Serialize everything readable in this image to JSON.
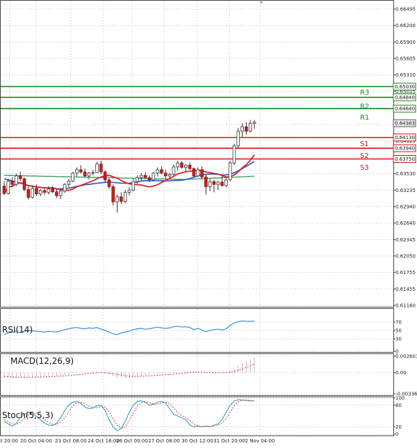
{
  "colors": {
    "resistance": "#1a8a1a",
    "support": "#d41010",
    "bull_candle": "#ffffff",
    "bear_candle": "#cc2020",
    "wick": "#333333",
    "ma_red": "#e02020",
    "ma_blue": "#3a5fd0",
    "ma_green": "#3aa060",
    "rsi": "#3a8ed8",
    "macd_hist": "#bbbbbb",
    "macd_signal": "#e03030",
    "stoch_main": "#30a0c0",
    "stoch_signal": "#e03030",
    "grid": "#b8b8b8",
    "panel_border": "#444444",
    "current_price_tag": "#eeeeee"
  },
  "chart_data": [
    {
      "type": "candlestick",
      "panel": "price",
      "yticks": [
        "0.66495",
        "0.66200",
        "0.65900",
        "0.65605",
        "0.65310",
        "0.65015",
        "0.64715",
        "0.64420",
        "0.64125",
        "0.63830",
        "0.63530",
        "0.63235",
        "0.62940",
        "0.62640",
        "0.62345",
        "0.62050",
        "0.61755",
        "0.61455",
        "0.61160"
      ],
      "ylim": [
        0.6116,
        0.665
      ],
      "current_price": "0.64383",
      "levels": [
        {
          "name": "R3",
          "value": "0.65030",
          "kind": "resistance"
        },
        {
          "name": "R2",
          "value": "0.64840",
          "kind": "resistance"
        },
        {
          "name": "R1",
          "value": "0.64640",
          "kind": "resistance"
        },
        {
          "name": "S1",
          "value": "0.64130",
          "kind": "support"
        },
        {
          "name": "S2",
          "value": "0.63940",
          "kind": "support"
        },
        {
          "name": "S3",
          "value": "0.63750",
          "kind": "support"
        }
      ],
      "xticks": [
        "ct 20:00",
        "20 Oct 04:00",
        "23 Oct 08:00",
        "24 Oct 16:00",
        "26 Oct 00:00",
        "27 Oct 08:00",
        "30 Oct 12:00",
        "31 Oct 20:00",
        "2 Nov 04:00"
      ],
      "ohlc": [
        [
          0.6327,
          0.6336,
          0.6311,
          0.6314
        ],
        [
          0.6314,
          0.634,
          0.6312,
          0.6336
        ],
        [
          0.6336,
          0.6343,
          0.6325,
          0.633
        ],
        [
          0.633,
          0.6349,
          0.6327,
          0.6345
        ],
        [
          0.6345,
          0.6352,
          0.6336,
          0.634
        ],
        [
          0.634,
          0.6342,
          0.6318,
          0.6321
        ],
        [
          0.6321,
          0.6326,
          0.6303,
          0.6307
        ],
        [
          0.6307,
          0.6328,
          0.6305,
          0.6323
        ],
        [
          0.6323,
          0.633,
          0.6309,
          0.6313
        ],
        [
          0.6313,
          0.6322,
          0.6309,
          0.6319
        ],
        [
          0.6319,
          0.6324,
          0.6311,
          0.6316
        ],
        [
          0.6316,
          0.6327,
          0.6312,
          0.6322
        ],
        [
          0.6322,
          0.6327,
          0.6314,
          0.6317
        ],
        [
          0.6317,
          0.6321,
          0.6306,
          0.631
        ],
        [
          0.631,
          0.6322,
          0.6304,
          0.6318
        ],
        [
          0.6318,
          0.6332,
          0.6315,
          0.633
        ],
        [
          0.633,
          0.634,
          0.6325,
          0.6336
        ],
        [
          0.6336,
          0.6352,
          0.6334,
          0.635
        ],
        [
          0.635,
          0.636,
          0.6344,
          0.6356
        ],
        [
          0.6356,
          0.6364,
          0.6349,
          0.6352
        ],
        [
          0.6352,
          0.6358,
          0.6342,
          0.6345
        ],
        [
          0.6345,
          0.6352,
          0.6339,
          0.635
        ],
        [
          0.635,
          0.6356,
          0.6346,
          0.6351
        ],
        [
          0.6351,
          0.637,
          0.635,
          0.6366
        ],
        [
          0.6366,
          0.6372,
          0.6348,
          0.6352
        ],
        [
          0.6352,
          0.6355,
          0.6334,
          0.6338
        ],
        [
          0.6338,
          0.634,
          0.6322,
          0.6326
        ],
        [
          0.6326,
          0.633,
          0.6293,
          0.6299
        ],
        [
          0.6299,
          0.6312,
          0.628,
          0.6308
        ],
        [
          0.6308,
          0.6316,
          0.6295,
          0.63
        ],
        [
          0.63,
          0.632,
          0.6296,
          0.6316
        ],
        [
          0.6316,
          0.6325,
          0.631,
          0.632
        ],
        [
          0.632,
          0.634,
          0.6318,
          0.6335
        ],
        [
          0.6335,
          0.6346,
          0.633,
          0.6342
        ],
        [
          0.6342,
          0.635,
          0.6336,
          0.6346
        ],
        [
          0.6346,
          0.6352,
          0.634,
          0.6342
        ],
        [
          0.6342,
          0.6346,
          0.6334,
          0.6338
        ],
        [
          0.6338,
          0.6352,
          0.6336,
          0.635
        ],
        [
          0.635,
          0.636,
          0.6344,
          0.6356
        ],
        [
          0.6356,
          0.6362,
          0.6348,
          0.635
        ],
        [
          0.635,
          0.6356,
          0.634,
          0.6345
        ],
        [
          0.6345,
          0.635,
          0.634,
          0.6348
        ],
        [
          0.6348,
          0.6365,
          0.6346,
          0.6361
        ],
        [
          0.6361,
          0.6372,
          0.6354,
          0.6368
        ],
        [
          0.6368,
          0.6371,
          0.6358,
          0.636
        ],
        [
          0.636,
          0.6366,
          0.6352,
          0.6364
        ],
        [
          0.6364,
          0.6369,
          0.6355,
          0.6358
        ],
        [
          0.6358,
          0.636,
          0.6342,
          0.6345
        ],
        [
          0.6345,
          0.636,
          0.6343,
          0.6356
        ],
        [
          0.6356,
          0.6362,
          0.634,
          0.6343
        ],
        [
          0.6343,
          0.6348,
          0.6312,
          0.6326
        ],
        [
          0.6326,
          0.634,
          0.6318,
          0.6335
        ],
        [
          0.6335,
          0.6338,
          0.6316,
          0.633
        ],
        [
          0.633,
          0.6336,
          0.632,
          0.6334
        ],
        [
          0.6334,
          0.6345,
          0.6326,
          0.6328
        ],
        [
          0.6328,
          0.6342,
          0.6325,
          0.6338
        ],
        [
          0.6338,
          0.6372,
          0.6336,
          0.6368
        ],
        [
          0.6368,
          0.6402,
          0.6364,
          0.6398
        ],
        [
          0.6398,
          0.643,
          0.6394,
          0.6424
        ],
        [
          0.6424,
          0.6438,
          0.6414,
          0.6432
        ],
        [
          0.6432,
          0.644,
          0.6418,
          0.6424
        ],
        [
          0.6424,
          0.6444,
          0.6422,
          0.6438
        ],
        [
          0.6438,
          0.6444,
          0.6428,
          0.644
        ]
      ]
    },
    {
      "type": "line",
      "panel": "rsi",
      "label": "RSI(14)",
      "yticks": [
        "70",
        "50",
        "30",
        "0"
      ],
      "ylim": [
        0,
        100
      ],
      "values": [
        40,
        44,
        46,
        47,
        45,
        48,
        50,
        49,
        48,
        47,
        46,
        48,
        47,
        46,
        49,
        52,
        54,
        56,
        57,
        55,
        54,
        56,
        55,
        57,
        53,
        50,
        46,
        42,
        40,
        44,
        46,
        48,
        52,
        54,
        55,
        53,
        54,
        56,
        58,
        56,
        55,
        56,
        59,
        60,
        58,
        59,
        57,
        52,
        55,
        51,
        47,
        50,
        52,
        53,
        51,
        54,
        62,
        68,
        71,
        73,
        72,
        72,
        72
      ]
    },
    {
      "type": "histogram",
      "panel": "macd",
      "label": "MACD(12,26,9)",
      "yticks": [
        "0.002603",
        "0.00",
        "-0.003364"
      ],
      "ylim": [
        -0.003364,
        0.002603
      ],
      "values": [
        -0.0008,
        -0.00082,
        -0.00085,
        -0.00078,
        -0.0007,
        -0.00072,
        -0.00075,
        -0.0007,
        -0.00066,
        -0.00064,
        -0.0006,
        -0.00058,
        -0.00052,
        -0.0005,
        -0.00048,
        -0.0004,
        -0.00035,
        -0.0002,
        -0.0001,
        0.0,
        5e-05,
        0.0001,
        0.00018,
        0.00025,
        0.00015,
        -0.0001,
        -0.0003,
        -0.0006,
        -0.0008,
        -0.00085,
        -0.0009,
        -0.00085,
        -0.0007,
        -0.0006,
        -0.00055,
        -0.00045,
        -0.0004,
        -0.0003,
        -0.00025,
        -0.0002,
        -0.00015,
        -0.00012,
        -5e-05,
        5e-05,
        0.0001,
        0.0002,
        0.00025,
        0.0002,
        0.00015,
        5e-05,
        -0.0001,
        -0.00015,
        -0.00012,
        -8e-05,
        -5e-05,
        0.0,
        0.0003,
        0.0007,
        0.0011,
        0.0015,
        0.0018,
        0.0021,
        0.0024
      ],
      "signal": [
        -0.0006,
        -0.00066,
        -0.00072,
        -0.00075,
        -0.00076,
        -0.00076,
        -0.00076,
        -0.00075,
        -0.00073,
        -0.00071,
        -0.00068,
        -0.00065,
        -0.00062,
        -0.00059,
        -0.00056,
        -0.00052,
        -0.00048,
        -0.00042,
        -0.00036,
        -0.00029,
        -0.00022,
        -0.00016,
        -0.0001,
        -4e-05,
        -1e-05,
        -3e-05,
        -8e-05,
        -0.00018,
        -0.0003,
        -0.00041,
        -0.00051,
        -0.00058,
        -0.0006,
        -0.0006,
        -0.00059,
        -0.00056,
        -0.00053,
        -0.00048,
        -0.00044,
        -0.00039,
        -0.00034,
        -0.0003,
        -0.00025,
        -0.00019,
        -0.00013,
        -6e-05,
        0.0,
        4e-05,
        6e-05,
        6e-05,
        3e-05,
        0.0,
        -2e-05,
        -3e-05,
        -3e-05,
        -2e-05,
        4e-05,
        0.00017,
        0.00035,
        0.00058,
        0.00082,
        0.00108,
        0.00134
      ]
    },
    {
      "type": "line",
      "panel": "stoch",
      "label": "Stoch(5,5,3)",
      "yticks": [
        "100",
        "80",
        "20",
        "0"
      ],
      "ylim": [
        0,
        100
      ],
      "values": [
        35,
        28,
        22,
        30,
        45,
        55,
        60,
        58,
        48,
        40,
        30,
        25,
        24,
        30,
        45,
        65,
        80,
        88,
        90,
        85,
        75,
        70,
        72,
        78,
        80,
        65,
        40,
        20,
        10,
        15,
        35,
        60,
        80,
        90,
        92,
        88,
        80,
        82,
        88,
        90,
        85,
        70,
        55,
        50,
        45,
        40,
        25,
        20,
        22,
        20,
        22,
        21,
        25,
        28,
        40,
        60,
        80,
        92,
        95,
        94,
        93,
        92,
        92
      ],
      "signal": [
        40,
        34,
        28,
        27,
        33,
        43,
        53,
        58,
        56,
        50,
        40,
        32,
        27,
        27,
        33,
        45,
        62,
        78,
        86,
        88,
        84,
        78,
        73,
        73,
        76,
        75,
        62,
        42,
        24,
        16,
        20,
        37,
        58,
        77,
        87,
        90,
        87,
        83,
        83,
        86,
        88,
        83,
        72,
        59,
        51,
        46,
        37,
        28,
        23,
        21,
        21,
        21,
        22,
        25,
        31,
        43,
        60,
        78,
        89,
        94,
        94,
        93,
        92
      ]
    }
  ]
}
